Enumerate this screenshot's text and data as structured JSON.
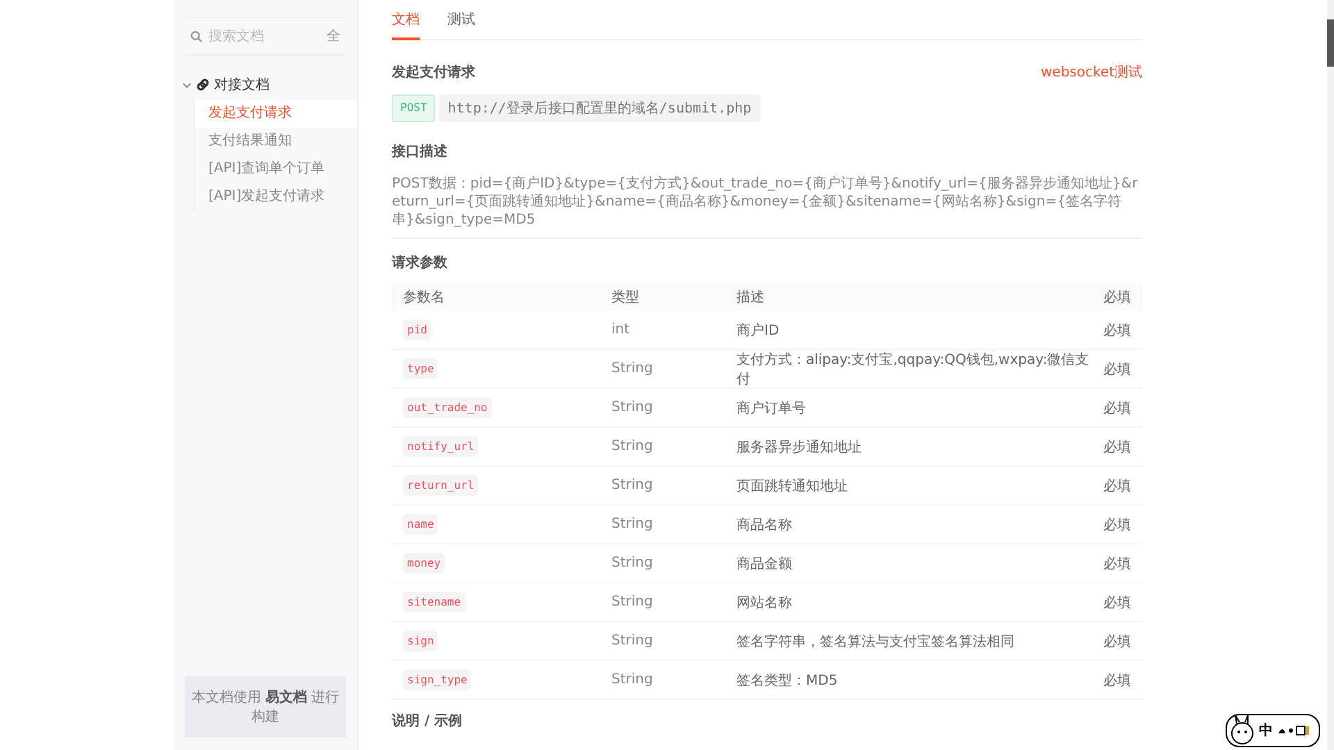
{
  "sidebar": {
    "search": {
      "placeholder": "搜索文档"
    },
    "expand_button": "全",
    "tree": [
      {
        "label": "对接文档",
        "expanded": true,
        "children": [
          {
            "label": "发起支付请求",
            "selected": true
          },
          {
            "label": "支付结果通知",
            "selected": false
          },
          {
            "label": "[API]查询单个订单",
            "selected": false
          },
          {
            "label": "[API]发起支付请求",
            "selected": false
          }
        ]
      }
    ],
    "footer": "本文档使用 **易文档** 进行构建"
  },
  "main": {
    "tabs": [
      {
        "label": "文档",
        "selected": true
      },
      {
        "label": "测试",
        "selected": false
      }
    ],
    "title": "发起支付请求",
    "link": "websocket测试",
    "method": "POST",
    "url": "http://登录后接口配置里的域名/submit.php",
    "description_heading": "接口描述",
    "description": "POST数据：pid={商户ID}&type={支付方式}&out_trade_no={商户订单号}&notify_url={服务器异步通知地址}&return_url={页面跳转通知地址}&name={商品名称}&money={金额}&sitename={网站名称}&sign={签名字符串}&sign_type=MD5",
    "params_heading": "请求参数",
    "table": {
      "columns": [
        "参数名",
        "类型",
        "描述",
        "必填"
      ],
      "rows": [
        {
          "name": "pid",
          "type": "int",
          "description": "商户ID",
          "required": "必填"
        },
        {
          "name": "type",
          "type": "String",
          "description": "支付方式：alipay:支付宝,qqpay:QQ钱包,wxpay:微信支付",
          "required": "必填"
        },
        {
          "name": "out_trade_no",
          "type": "String",
          "description": "商户订单号",
          "required": "必填"
        },
        {
          "name": "notify_url",
          "type": "String",
          "description": "服务器异步通知地址",
          "required": "必填"
        },
        {
          "name": "return_url",
          "type": "String",
          "description": "页面跳转通知地址",
          "required": "必填"
        },
        {
          "name": "name",
          "type": "String",
          "description": "商品名称",
          "required": "必填"
        },
        {
          "name": "money",
          "type": "String",
          "description": "商品金额",
          "required": "必填"
        },
        {
          "name": "sitename",
          "type": "String",
          "description": "网站名称",
          "required": "必填"
        },
        {
          "name": "sign",
          "type": "String",
          "description": "签名字符串，签名算法与支付宝签名算法相同",
          "required": "必填"
        },
        {
          "name": "sign_type",
          "type": "String",
          "description": "签名类型：MD5",
          "required": "必填"
        }
      ]
    },
    "next_heading": "说明 / 示例"
  },
  "ime": {
    "label": "中"
  }
}
